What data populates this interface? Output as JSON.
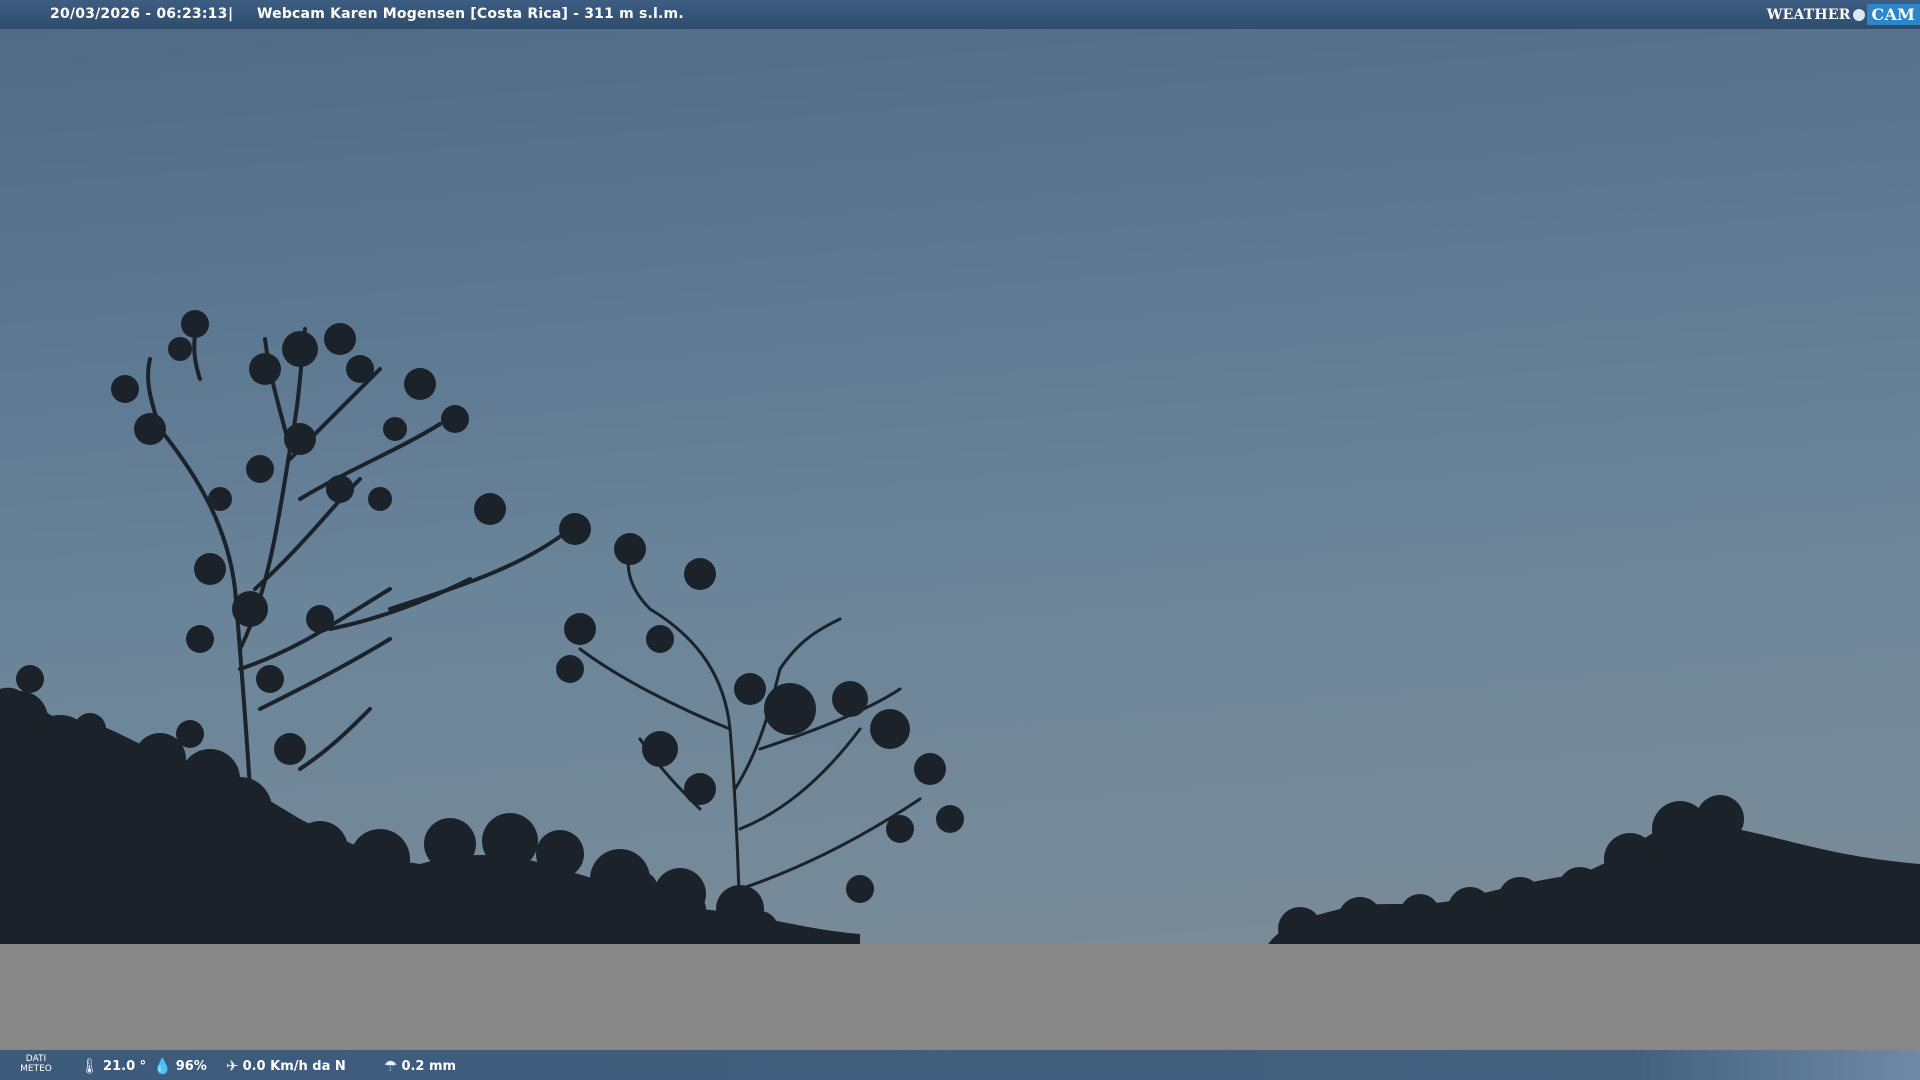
{
  "header": {
    "datetime": "20/03/2026 - 06:23:13",
    "separator": "|",
    "title": "Webcam Karen Mogensen [Costa Rica]  - 311 m s.l.m.",
    "logo_word": "WEATHER",
    "logo_cam": "CAM"
  },
  "footer": {
    "dati_label_1": "DATI",
    "dati_label_2": "METEO",
    "temperature": "21.0 °",
    "humidity": "96%",
    "wind": "0.0 Km/h da N",
    "rain": "0.2 mm",
    "icons": [
      "thermometer-icon",
      "humidity-icon",
      "wind-icon",
      "rain-icon"
    ]
  },
  "colors": {
    "bar": "#3d5d82",
    "sky": "#5a7690",
    "foliage": "#1b222a",
    "mask": "#878787"
  }
}
